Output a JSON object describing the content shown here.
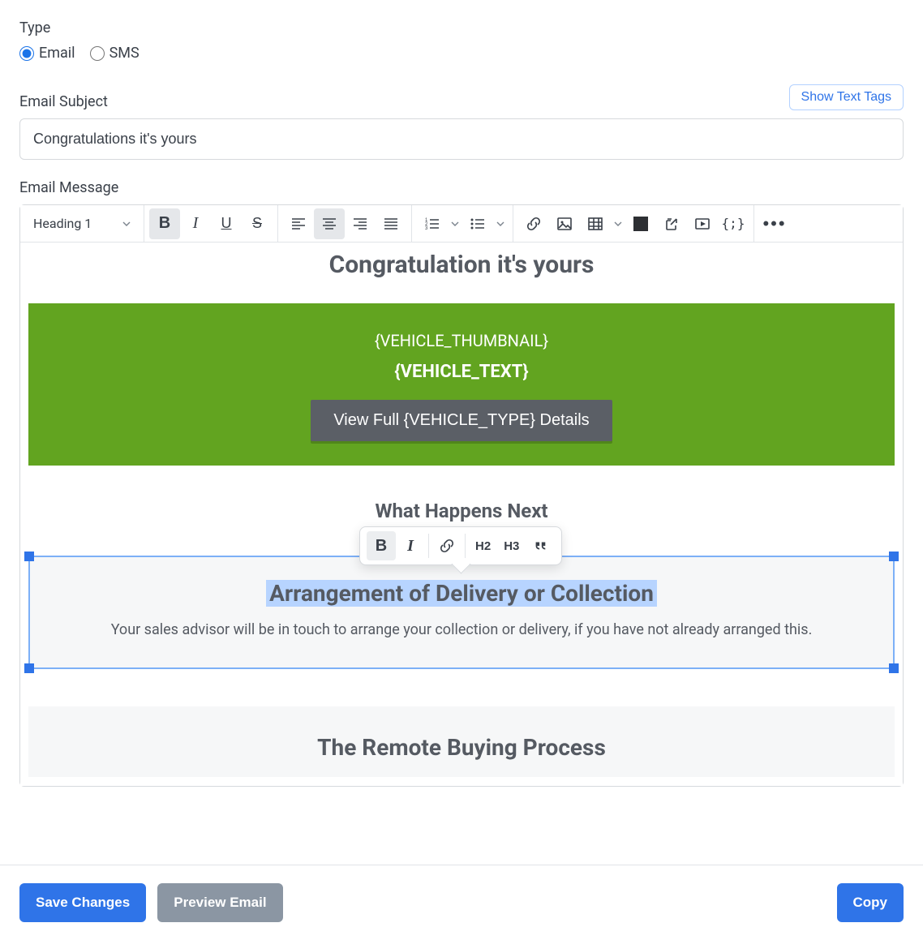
{
  "type": {
    "label": "Type",
    "options": [
      {
        "label": "Email",
        "checked": true
      },
      {
        "label": "SMS",
        "checked": false
      }
    ]
  },
  "subject": {
    "label": "Email Subject",
    "value": "Congratulations it's yours",
    "show_tags_label": "Show Text Tags"
  },
  "message": {
    "label": "Email Message"
  },
  "toolbar": {
    "heading_select": "Heading 1"
  },
  "content": {
    "title": "Congratulation it's yours",
    "vehicle_thumb": "{VEHICLE_THUMBNAIL}",
    "vehicle_text": "{VEHICLE_TEXT}",
    "view_full": "View Full {VEHICLE_TYPE} Details",
    "what_happens": "What Happens Next",
    "arrangement_heading": "Arrangement of Delivery or Collection",
    "arrangement_body": "Your sales advisor will be in touch to arrange your collection or delivery, if you have not already arranged this.",
    "remote_heading": "The Remote Buying Process"
  },
  "mini": {
    "h2": "H2",
    "h3": "H3"
  },
  "footer": {
    "save": "Save Changes",
    "preview": "Preview Email",
    "copy": "Copy"
  }
}
